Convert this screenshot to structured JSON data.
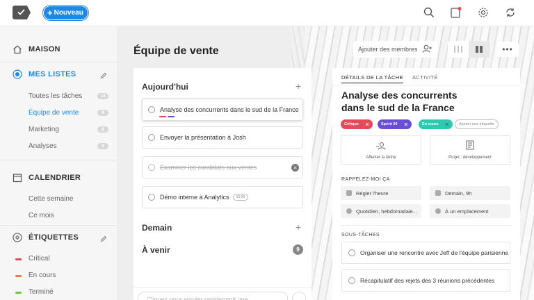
{
  "topbar": {
    "new_label": "Nouveau"
  },
  "sidebar": {
    "home": "MAISON",
    "lists_header": "MES LISTES",
    "lists": [
      {
        "label": "Toutes les tâches",
        "count": "14"
      },
      {
        "label": "Équipe de vente",
        "count": "9"
      },
      {
        "label": "Marketing",
        "count": "6"
      },
      {
        "label": "Analyses",
        "count": "9"
      }
    ],
    "calendar_header": "CALENDRIER",
    "calendar_items": [
      "Cette semaine",
      "Ce mois"
    ],
    "tags_header": "ÉTIQUETTES",
    "tags": [
      {
        "label": "Critical",
        "color": "#e8495a"
      },
      {
        "label": "En cours",
        "color": "#f27a3c"
      },
      {
        "label": "Terminé",
        "color": "#6bc93f"
      }
    ]
  },
  "main": {
    "title": "Équipe de vente",
    "members_label": "Ajouter des membres",
    "more_label": "•••"
  },
  "list": {
    "today": "Aujourd'hui",
    "tasks": [
      {
        "label": "Analyse des concurrents dans le sud de la France"
      },
      {
        "label": "Envoyer la présentation à Josh"
      },
      {
        "label": "Examiner les candidats aux ventes"
      },
      {
        "label": "Démo interne à Analytics",
        "time": "10:00"
      }
    ],
    "tomorrow": "Demain",
    "upcoming": "À venir",
    "upcoming_count": "9",
    "quick_add_placeholder": "Cliquez pour ajouter rapidement une"
  },
  "detail": {
    "tab_details": "DÉTAILS DE LA TÂCHE",
    "tab_activity": "ACTIVITÉ",
    "title": "Analyse des concurrents dans le sud de la France",
    "chips": [
      {
        "label": "Critique",
        "color": "#e8495a"
      },
      {
        "label": "Sprint 34",
        "color": "#6a4fd6"
      },
      {
        "label": "En cours",
        "color": "#2ec9b1"
      }
    ],
    "add_tag": "Ajouter une étiquette",
    "assign_label": "Affecter la tâche",
    "project_label": "Projet : développement",
    "remind_header": "RAPPELEZ-MOI ÇA",
    "remind": [
      "Régler l'heure",
      "Demain, 9h",
      "Quotidien, hebdomadaie...",
      "À un emplacement"
    ],
    "subtasks_header": "SOUS-TÂCHES",
    "subtasks": [
      "Organiser une rencontre avec Jeff de l'équipe parisienne",
      "Récapitulatif des rejets des 3 réunions précédentes"
    ]
  },
  "colors": {
    "accent": "#1e88e5"
  }
}
